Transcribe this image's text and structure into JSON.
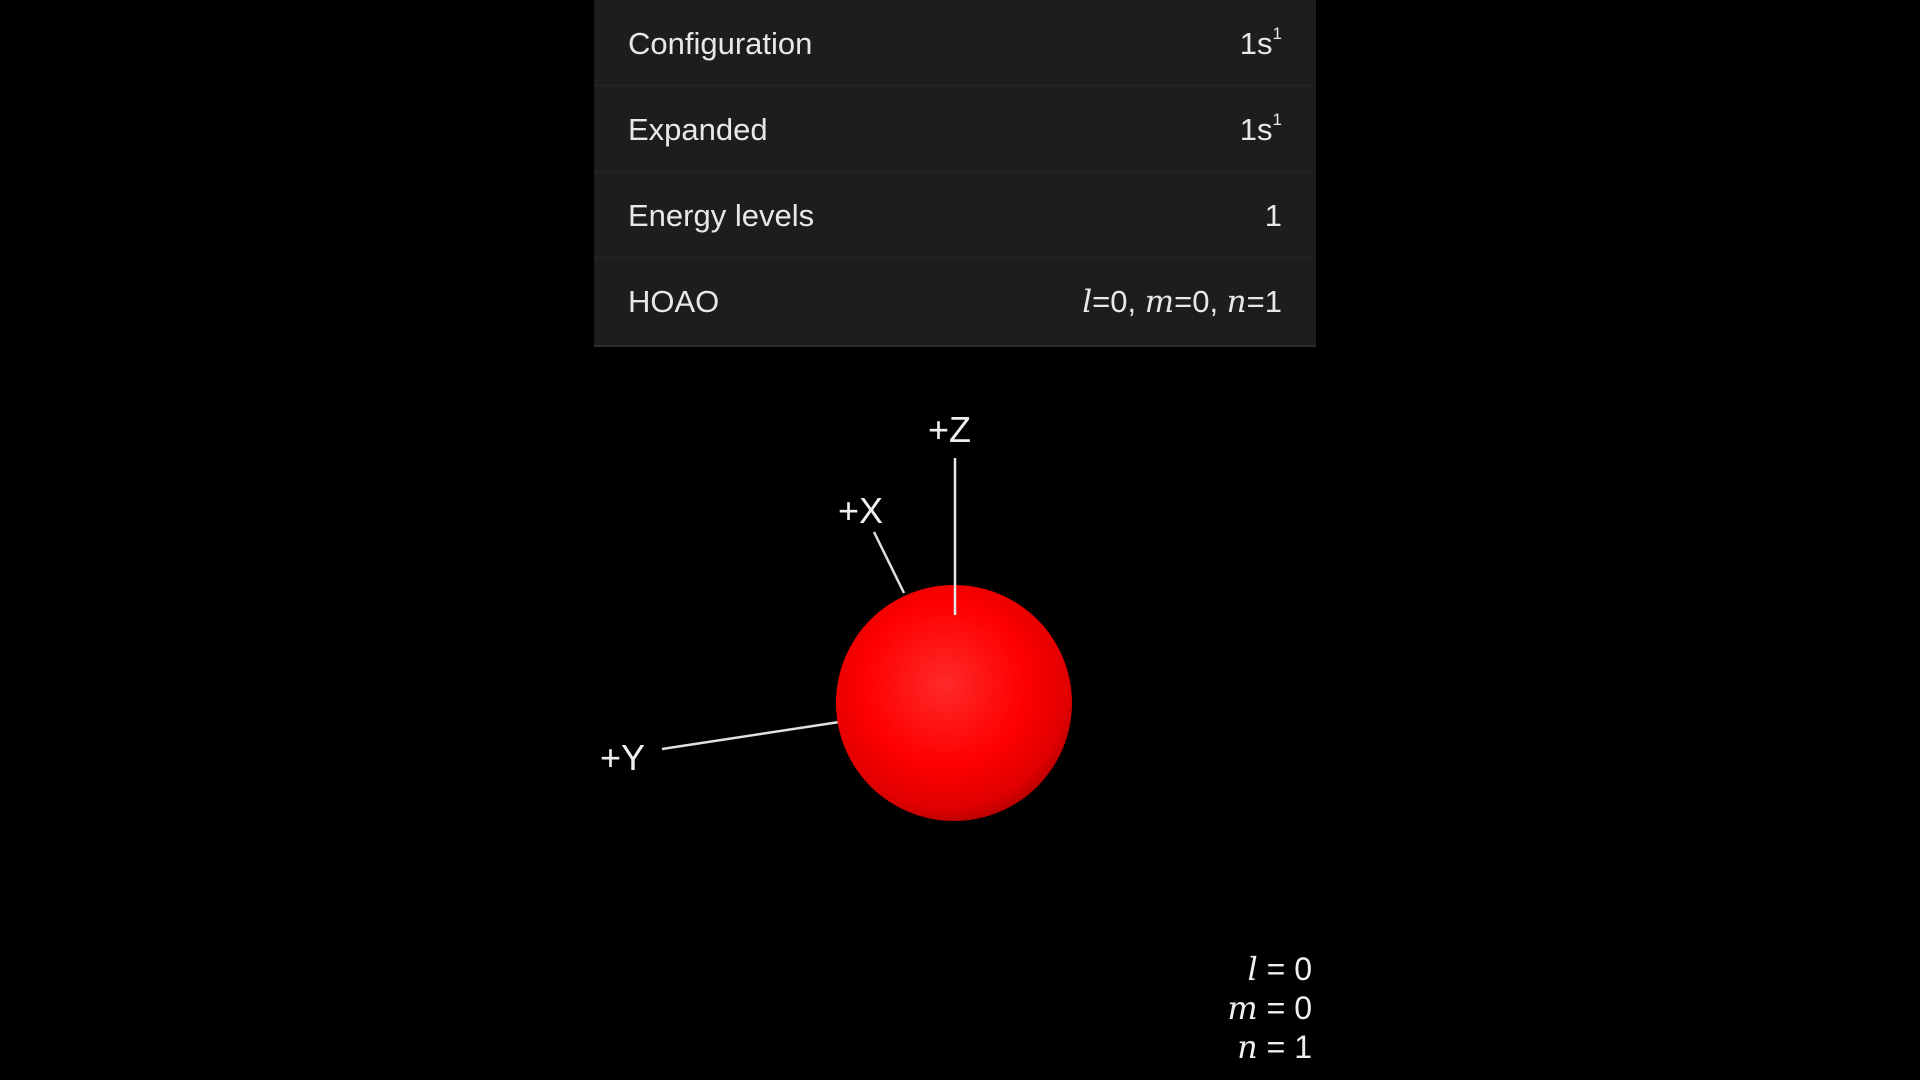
{
  "info_panel": {
    "rows": [
      {
        "label": "Configuration",
        "value_base": "1s",
        "value_sup": "1"
      },
      {
        "label": "Expanded",
        "value_base": "1s",
        "value_sup": "1"
      },
      {
        "label": "Energy levels",
        "value": "1"
      },
      {
        "label": "HOAO",
        "l_symbol": "l",
        "l_value": "=0, ",
        "m_symbol": "m",
        "m_value": "=0, ",
        "n_symbol": "n",
        "n_value": "=1"
      }
    ]
  },
  "axes": {
    "z_label": "+Z",
    "x_label": "+X",
    "y_label": "+Y"
  },
  "orbital": {
    "name": "1s",
    "color": "#ff0000"
  },
  "quantum_numbers": {
    "l_symbol": "l",
    "l_text": " = 0",
    "m_symbol": "m",
    "m_text": " = 0",
    "n_symbol": "n",
    "n_text": " = 1"
  },
  "colors": {
    "background": "#000000",
    "panel": "#1d1d1d",
    "text": "#e8e8e8",
    "axis": "#e0e0e0",
    "orbital": "#ff0000"
  }
}
